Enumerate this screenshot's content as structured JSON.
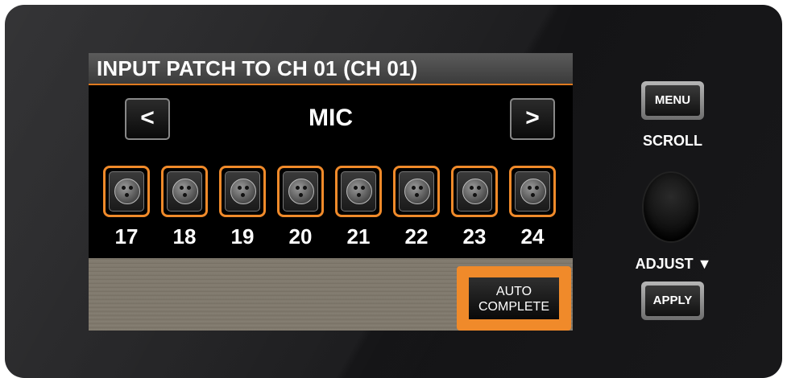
{
  "screen": {
    "title": "INPUT PATCH TO CH 01 (CH 01)",
    "prev_label": "<",
    "next_label": ">",
    "source": "MIC",
    "inputs": [
      "17",
      "18",
      "19",
      "20",
      "21",
      "22",
      "23",
      "24"
    ],
    "auto_complete_line1": "AUTO",
    "auto_complete_line2": "COMPLETE"
  },
  "controls": {
    "menu_label": "MENU",
    "scroll_label": "SCROLL",
    "adjust_label": "ADJUST ▼",
    "apply_label": "APPLY"
  },
  "colors": {
    "accent": "#f08a2a",
    "screen_bg": "#000000",
    "panel_bg": "#1c1c1e"
  }
}
